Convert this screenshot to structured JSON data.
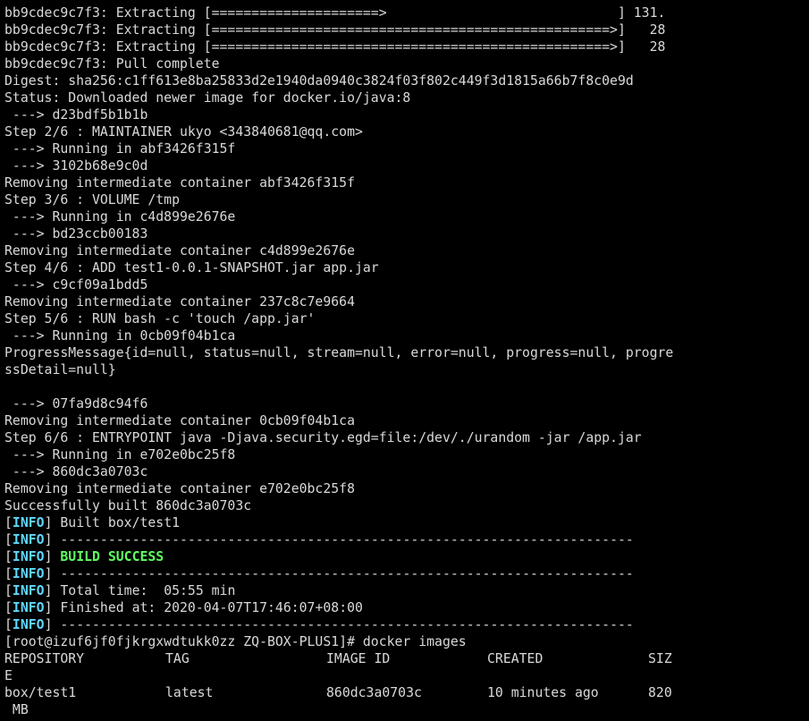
{
  "terminal": {
    "lines": [
      "bb9cdec9c7f3: Extracting [=====================>                             ] 131.",
      "bb9cdec9c7f3: Extracting [==================================================>]   28",
      "bb9cdec9c7f3: Extracting [==================================================>]   28",
      "bb9cdec9c7f3: Pull complete",
      "Digest: sha256:c1ff613e8ba25833d2e1940da0940c3824f03f802c449f3d1815a66b7f8c0e9d",
      "Status: Downloaded newer image for docker.io/java:8",
      " ---> d23bdf5b1b1b",
      "Step 2/6 : MAINTAINER ukyo <343840681@qq.com>",
      " ---> Running in abf3426f315f",
      " ---> 3102b68e9c0d",
      "Removing intermediate container abf3426f315f",
      "Step 3/6 : VOLUME /tmp",
      " ---> Running in c4d899e2676e",
      " ---> bd23ccb00183",
      "Removing intermediate container c4d899e2676e",
      "Step 4/6 : ADD test1-0.0.1-SNAPSHOT.jar app.jar",
      " ---> c9cf09a1bdd5",
      "Removing intermediate container 237c8c7e9664",
      "Step 5/6 : RUN bash -c 'touch /app.jar'",
      " ---> Running in 0cb09f04b1ca"
    ],
    "progress_message": "ProgressMessage{id=null, status=null, stream=null, error=null, progress=null, progressDetail=null}",
    "blank": "",
    "lines2": [
      " ---> 07fa9d8c94f6",
      "Removing intermediate container 0cb09f04b1ca",
      "Step 6/6 : ENTRYPOINT java -Djava.security.egd=file:/dev/./urandom -jar /app.jar",
      " ---> Running in e702e0bc25f8",
      " ---> 860dc3a0703c",
      "Removing intermediate container e702e0bc25f8",
      "Successfully built 860dc3a0703c"
    ],
    "info_tag": "INFO",
    "info_lines": [
      {
        "text": " Built box/test1",
        "style": "plain"
      },
      {
        "text": " ------------------------------------------------------------------------",
        "style": "plain"
      },
      {
        "text": " BUILD SUCCESS",
        "style": "success"
      },
      {
        "text": " ------------------------------------------------------------------------",
        "style": "plain"
      },
      {
        "text": " Total time:  05:55 min",
        "style": "plain"
      },
      {
        "text": " Finished at: 2020-04-07T17:46:07+08:00",
        "style": "plain"
      },
      {
        "text": " ------------------------------------------------------------------------",
        "style": "plain"
      }
    ],
    "prompt": "[root@izuf6jf0fjkrgxwdtukk0zz ZQ-BOX-PLUS1]# docker images",
    "table": {
      "headers": [
        "REPOSITORY",
        "TAG",
        "IMAGE ID",
        "CREATED",
        "SIZ"
      ],
      "header_wrap": "E",
      "row": [
        "box/test1",
        "latest",
        "860dc3a0703c",
        "10 minutes ago",
        "820"
      ],
      "row_wrap": " MB"
    }
  },
  "colors": {
    "background": "#000000",
    "text": "#d9d9d9",
    "info": "#5fd7ff",
    "success": "#5fff5f"
  }
}
